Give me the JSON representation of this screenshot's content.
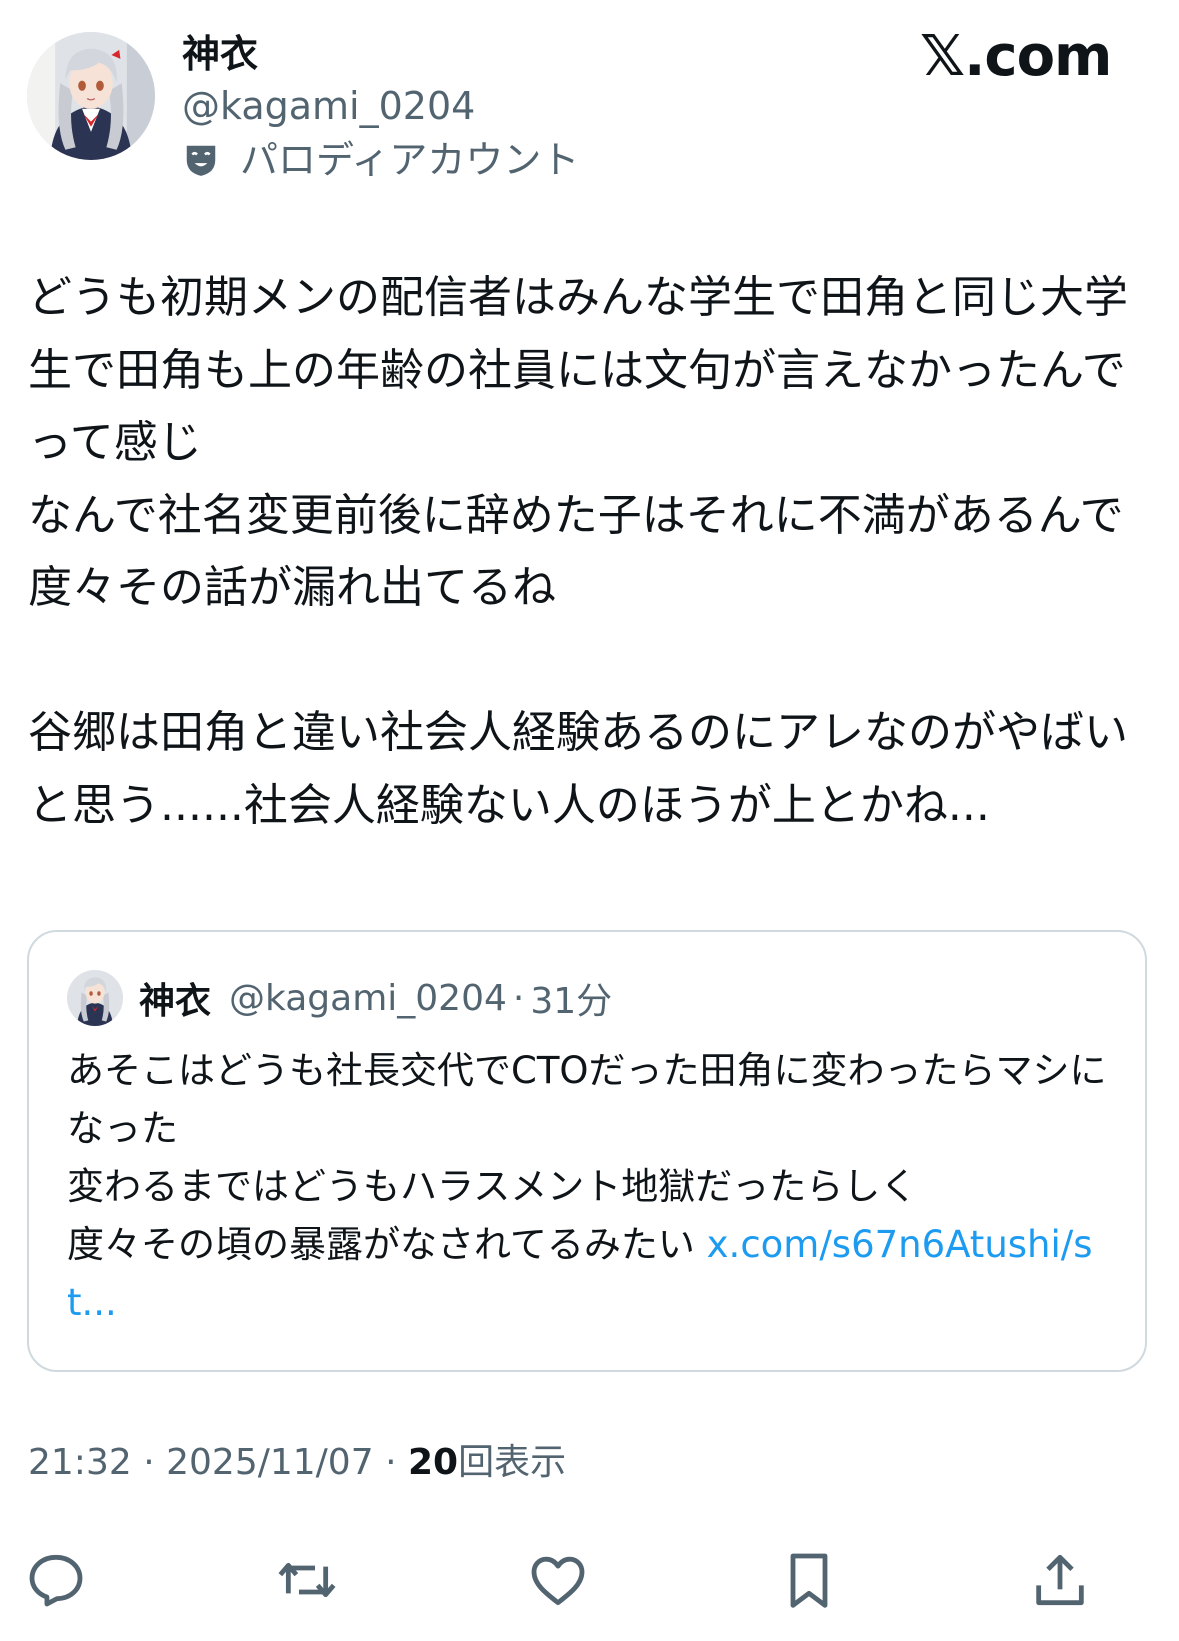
{
  "author": {
    "display_name": "神衣",
    "handle": "@kagami_0204",
    "parody_label": "パロディアカウント",
    "parody_icon": "theater-mask-icon",
    "avatar": "anime-avatar"
  },
  "brand": "𝕏.com",
  "tweet": {
    "text": "どうも初期メンの配信者はみんな学生で田角と同じ大学生で田角も上の年齢の社員には文句が言えなかったんでって感じ\nなんで社名変更前後に辞めた子はそれに不満があるんで度々その話が漏れ出てるね\n\n谷郷は田角と違い社会人経験あるのにアレなのがやばいと思う......社会人経験ない人のほうが上とかね..."
  },
  "quote": {
    "display_name": "神衣",
    "handle": "@kagami_0204",
    "separator": "·",
    "time": "31分",
    "text": "あそこはどうも社長交代でCTOだった田角に変わったらマシになった\n変わるまではどうもハラスメント地獄だったらしく\n度々その頃の暴露がなされてるみたい ",
    "link": "x.com/s67n6Atushi/st..."
  },
  "meta": {
    "time": "21:32",
    "separator": "·",
    "date": "2025/11/07",
    "views_count": "20",
    "views_label": "回表示"
  },
  "actions": [
    {
      "name": "reply",
      "icon": "reply-icon"
    },
    {
      "name": "repost",
      "icon": "repost-icon"
    },
    {
      "name": "like",
      "icon": "heart-icon"
    },
    {
      "name": "bookmark",
      "icon": "bookmark-icon"
    },
    {
      "name": "share",
      "icon": "share-icon"
    }
  ],
  "colors": {
    "text": "#0f1419",
    "secondary": "#536471",
    "link": "#1d9bf0",
    "border": "#cfd9de"
  }
}
